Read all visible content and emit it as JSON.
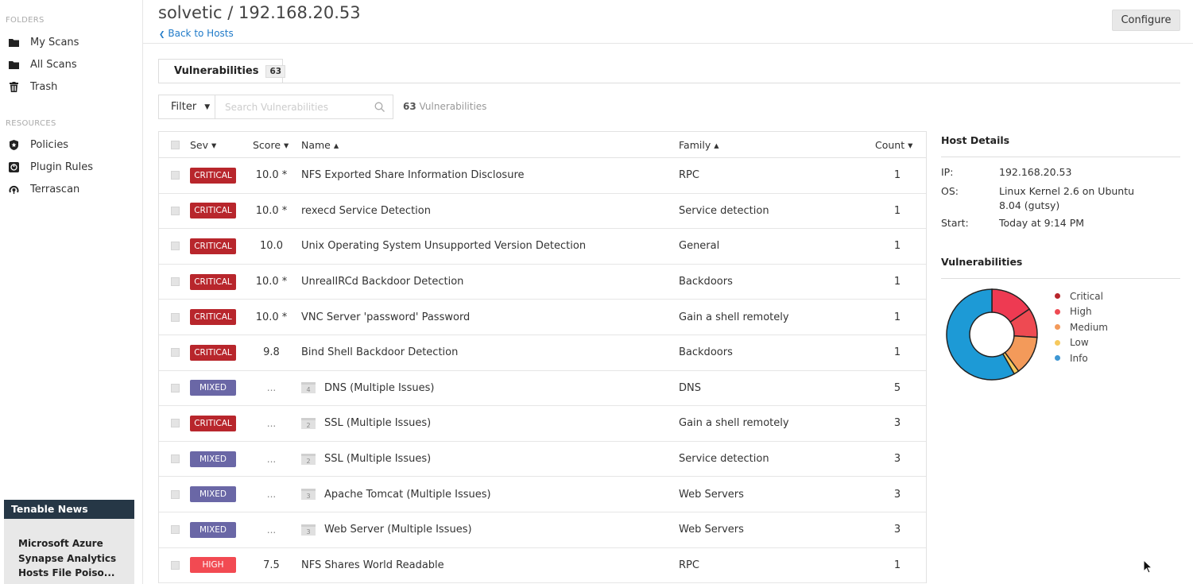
{
  "sidebar": {
    "folders_header": "FOLDERS",
    "folders": [
      {
        "label": "My Scans",
        "icon": "folder-icon"
      },
      {
        "label": "All Scans",
        "icon": "folder-icon"
      },
      {
        "label": "Trash",
        "icon": "trash-icon"
      }
    ],
    "resources_header": "RESOURCES",
    "resources": [
      {
        "label": "Policies",
        "icon": "shield-icon"
      },
      {
        "label": "Plugin Rules",
        "icon": "plugin-icon"
      },
      {
        "label": "Terrascan",
        "icon": "terrascan-icon"
      }
    ],
    "news": {
      "header": "Tenable News",
      "lines": [
        "Microsoft Azure",
        "Synapse Analytics",
        "Hosts File Poiso..."
      ]
    }
  },
  "header": {
    "title": "solvetic / 192.168.20.53",
    "back_label": "Back to Hosts",
    "configure_label": "Configure"
  },
  "tabs": [
    {
      "label": "Vulnerabilities",
      "badge": "63"
    }
  ],
  "toolbar": {
    "filter_label": "Filter",
    "search_placeholder": "Search Vulnerabilities",
    "count_number": "63",
    "count_text": "Vulnerabilities"
  },
  "table": {
    "columns": {
      "sev": "Sev ▾",
      "score": "Score ▾",
      "name": "Name ▴",
      "family": "Family ▴",
      "count": "Count ▾"
    },
    "rows": [
      {
        "sev": "CRITICAL",
        "sev_class": "critical",
        "score": "10.0 *",
        "name": "NFS Exported Share Information Disclosure",
        "family": "RPC",
        "count": "1"
      },
      {
        "sev": "CRITICAL",
        "sev_class": "critical",
        "score": "10.0 *",
        "name": "rexecd Service Detection",
        "family": "Service detection",
        "count": "1"
      },
      {
        "sev": "CRITICAL",
        "sev_class": "critical",
        "score": "10.0",
        "name": "Unix Operating System Unsupported Version Detection",
        "family": "General",
        "count": "1"
      },
      {
        "sev": "CRITICAL",
        "sev_class": "critical",
        "score": "10.0 *",
        "name": "UnrealIRCd Backdoor Detection",
        "family": "Backdoors",
        "count": "1"
      },
      {
        "sev": "CRITICAL",
        "sev_class": "critical",
        "score": "10.0 *",
        "name": "VNC Server 'password' Password",
        "family": "Gain a shell remotely",
        "count": "1"
      },
      {
        "sev": "CRITICAL",
        "sev_class": "critical",
        "score": "9.8",
        "name": "Bind Shell Backdoor Detection",
        "family": "Backdoors",
        "count": "1"
      },
      {
        "sev": "MIXED",
        "sev_class": "mixed",
        "score": "...",
        "group": "4",
        "name": "DNS (Multiple Issues)",
        "family": "DNS",
        "count": "5"
      },
      {
        "sev": "CRITICAL",
        "sev_class": "critical",
        "score": "...",
        "group": "2",
        "name": "SSL (Multiple Issues)",
        "family": "Gain a shell remotely",
        "count": "3"
      },
      {
        "sev": "MIXED",
        "sev_class": "mixed",
        "score": "...",
        "group": "2",
        "name": "SSL (Multiple Issues)",
        "family": "Service detection",
        "count": "3"
      },
      {
        "sev": "MIXED",
        "sev_class": "mixed",
        "score": "...",
        "group": "3",
        "name": "Apache Tomcat (Multiple Issues)",
        "family": "Web Servers",
        "count": "3"
      },
      {
        "sev": "MIXED",
        "sev_class": "mixed",
        "score": "...",
        "group": "3",
        "name": "Web Server (Multiple Issues)",
        "family": "Web Servers",
        "count": "3"
      },
      {
        "sev": "HIGH",
        "sev_class": "high",
        "score": "7.5",
        "name": "NFS Shares World Readable",
        "family": "RPC",
        "count": "1"
      }
    ]
  },
  "host_details": {
    "header": "Host Details",
    "ip_label": "IP:",
    "ip": "192.168.20.53",
    "os_label": "OS:",
    "os": "Linux Kernel 2.6 on Ubuntu 8.04 (gutsy)",
    "start_label": "Start:",
    "start": "Today at 9:14 PM"
  },
  "vuln_chart": {
    "header": "Vulnerabilities",
    "legend": [
      {
        "label": "Critical",
        "color": "#b8262c"
      },
      {
        "label": "High",
        "color": "#ee4a52"
      },
      {
        "label": "Medium",
        "color": "#f39a5a"
      },
      {
        "label": "Low",
        "color": "#f6c95d"
      },
      {
        "label": "Info",
        "color": "#3e97d3"
      }
    ],
    "segments": [
      {
        "name": "Critical",
        "color": "#ee3a52",
        "fraction": 0.155
      },
      {
        "name": "High",
        "color": "#ee4a52",
        "fraction": 0.105
      },
      {
        "name": "Medium",
        "color": "#f39a5a",
        "fraction": 0.14
      },
      {
        "name": "Low",
        "color": "#f6c95d",
        "fraction": 0.018
      },
      {
        "name": "Info",
        "color": "#1d9ad6",
        "fraction": 0.582
      }
    ]
  }
}
